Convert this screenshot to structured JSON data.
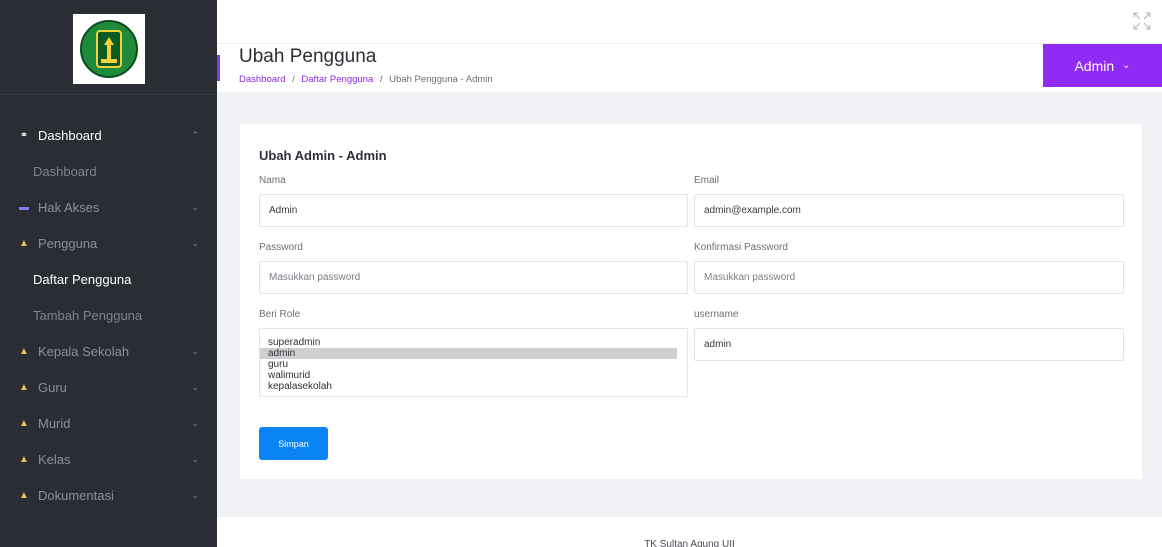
{
  "sidebar": {
    "logo_alt": "school-crest-logo",
    "items": [
      {
        "label": "Dashboard",
        "icon": "dashboard-icon",
        "open": true,
        "subs": [
          {
            "label": "Dashboard"
          }
        ]
      },
      {
        "label": "Hak Akses",
        "icon": "key-icon"
      },
      {
        "label": "Pengguna",
        "icon": "user-icon",
        "open": true,
        "subs": [
          {
            "label": "Daftar Pengguna",
            "active": true
          },
          {
            "label": "Tambah Pengguna"
          }
        ]
      },
      {
        "label": "Kepala Sekolah",
        "icon": "user-icon"
      },
      {
        "label": "Guru",
        "icon": "user-icon"
      },
      {
        "label": "Murid",
        "icon": "user-icon"
      },
      {
        "label": "Kelas",
        "icon": "user-icon"
      },
      {
        "label": "Dokumentasi",
        "icon": "user-icon"
      }
    ]
  },
  "header": {
    "title": "Ubah Pengguna",
    "breadcrumb": [
      "Dashboard",
      "Daftar Pengguna",
      "Ubah Pengguna - Admin"
    ],
    "user_label": "Admin"
  },
  "form": {
    "title": "Ubah Admin - Admin",
    "nama_label": "Nama",
    "nama_value": "Admin",
    "email_label": "Email",
    "email_value": "admin@example.com",
    "password_label": "Password",
    "password_placeholder": "Masukkan password",
    "confirm_label": "Konfirmasi Password",
    "confirm_placeholder": "Masukkan password",
    "role_label": "Beri Role",
    "roles": [
      "superadmin",
      "admin",
      "guru",
      "walimurid",
      "kepalasekolah"
    ],
    "selected_role": "admin",
    "username_label": "username",
    "username_value": "admin",
    "save_label": "Simpan"
  },
  "footer": {
    "text": "TK Sultan Agung UII"
  },
  "colors": {
    "accent": "#8f2bf2",
    "primary_button": "#0a84f5",
    "sidebar_bg": "#2b2d35"
  }
}
